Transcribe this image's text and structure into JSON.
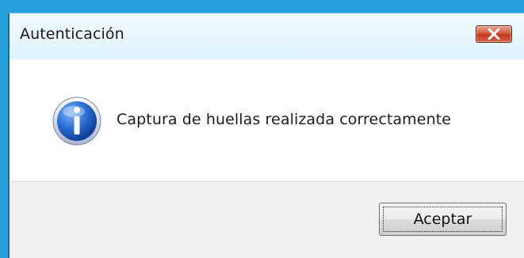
{
  "dialog": {
    "title": "Autenticación",
    "message": "Captura de huellas realizada correctamente",
    "icon": "information-icon",
    "ok_label": "Aceptar",
    "close_icon": "close-x-icon"
  },
  "colors": {
    "window_accent": "#26a0da",
    "close_button": "#c7432a",
    "content_background": "#ffffff",
    "footer_background": "#f0f0f0",
    "info_icon_blue": "#1f5fc3"
  }
}
